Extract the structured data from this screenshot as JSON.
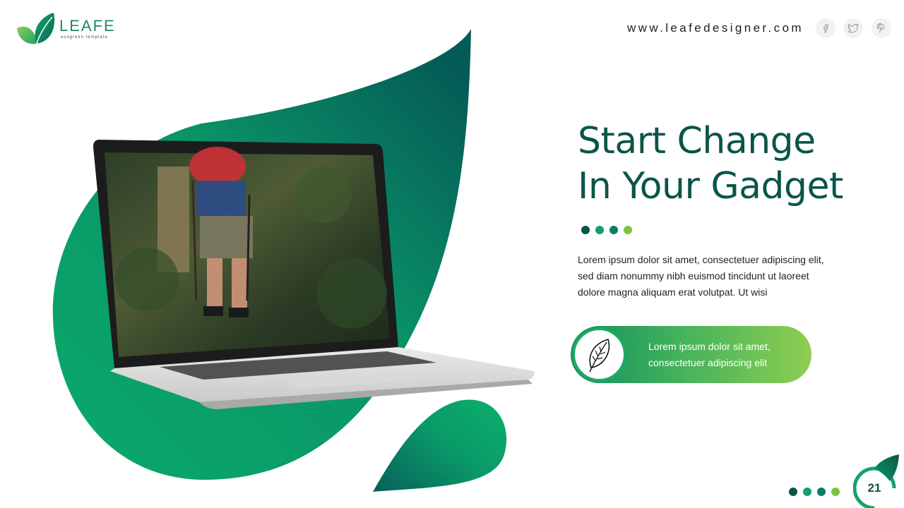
{
  "logo": {
    "name": "LEAFE",
    "tagline": "ecogreen template"
  },
  "header": {
    "website": "www.leafedesigner.com",
    "social": [
      {
        "icon": "facebook-icon",
        "glyph": "f"
      },
      {
        "icon": "twitter-icon",
        "glyph": "t"
      },
      {
        "icon": "pinterest-icon",
        "glyph": "p"
      }
    ]
  },
  "title": {
    "line1": "Start Change",
    "line2": "In Your Gadget"
  },
  "dots": [
    "#0b5548",
    "#139f6b",
    "#0f7a6a",
    "#7cc341"
  ],
  "body": {
    "paragraph": "Lorem ipsum dolor sit amet, consectetuer adipiscing elit, sed diam nonummy  nibh euismod tincidunt ut laoreet dolore magna aliquam erat volutpat. Ut wisi"
  },
  "callout": {
    "icon": "leaf-icon",
    "line1": "Lorem ipsum dolor sit amet,",
    "line2": "consectetuer adipiscing elit"
  },
  "footer": {
    "dots": [
      "#0b5548",
      "#139f6b",
      "#0f7a6a",
      "#7cc341"
    ],
    "page_number": "21"
  },
  "colors": {
    "primary_dark": "#0b5548",
    "primary": "#0aa066",
    "accent": "#8fce52"
  }
}
